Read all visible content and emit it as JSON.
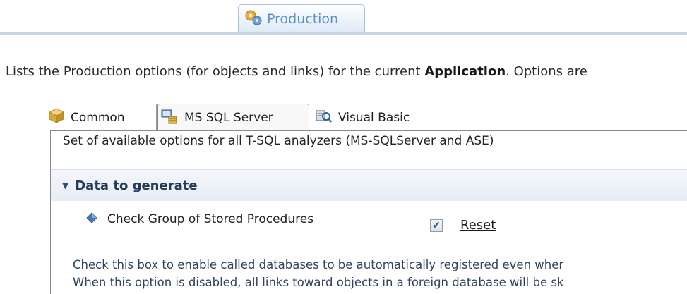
{
  "main_tab": {
    "label": "Production",
    "icon": "production-gears-icon"
  },
  "description": {
    "prefix": "Lists the Production options (for objects and links) for the current ",
    "bold": "Application",
    "suffix": ". Options are"
  },
  "sub_tabs": [
    {
      "label": "Common",
      "icon": "cube-icon",
      "selected": false
    },
    {
      "label": "MS SQL Server",
      "icon": "sql-server-icon",
      "selected": true
    },
    {
      "label": "Visual Basic",
      "icon": "visual-basic-icon",
      "selected": false
    }
  ],
  "option_set_label": "Set of available options for all T-SQL analyzers (MS-SQLServer and ASE)",
  "section": {
    "title": "Data to generate",
    "expanded": true
  },
  "option": {
    "label": "Check Group of Stored Procedures",
    "checked": true,
    "reset_label": "Reset"
  },
  "help_text": [
    "Check this box to enable called databases to be automatically registered even wher",
    "When this option is disabled, all links toward objects in a foreign database will be sk"
  ],
  "colors": {
    "accent": "#5b8fd0",
    "section_title": "#243c5a",
    "help_text": "#2f4460"
  }
}
